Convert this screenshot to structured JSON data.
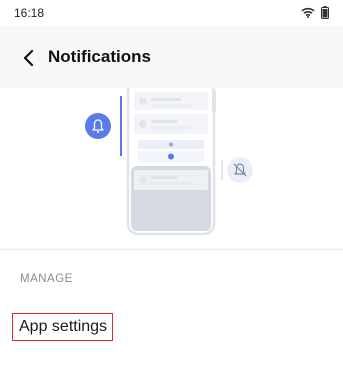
{
  "status_bar": {
    "time": "16:18",
    "icons": [
      "wifi-icon",
      "battery-icon"
    ]
  },
  "toolbar": {
    "back_icon": "back-arrow-icon",
    "title": "Notifications"
  },
  "illustration": {
    "icons": [
      "bell-active-icon",
      "bell-muted-icon"
    ],
    "colors": {
      "accent": "#5b7be8",
      "phone_frame": "#dfe3ea",
      "muted_bubble": "#e9eef8"
    }
  },
  "manage_section": {
    "header": "MANAGE",
    "items": [
      {
        "label": "App settings",
        "highlighted": true
      }
    ]
  }
}
